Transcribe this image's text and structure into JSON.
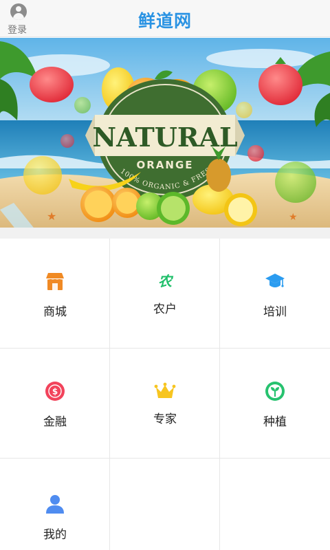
{
  "header": {
    "title": "鲜道网",
    "login_label": "登录"
  },
  "banner": {
    "headline": "NATURAL",
    "subline": "ORANGE",
    "arc_text": "100% ORGANIC & FRESH"
  },
  "menu": {
    "items": [
      {
        "label": "商城",
        "icon": "shop-icon",
        "color": "#f08a24"
      },
      {
        "label": "农户",
        "icon": "farmer-icon",
        "color": "#1fbf6a"
      },
      {
        "label": "培训",
        "icon": "graduation-cap-icon",
        "color": "#2b9cf0"
      },
      {
        "label": "金融",
        "icon": "dollar-coin-icon",
        "color": "#f2435b"
      },
      {
        "label": "专家",
        "icon": "crown-icon",
        "color": "#f7c520"
      },
      {
        "label": "种植",
        "icon": "sprout-icon",
        "color": "#27c26f"
      },
      {
        "label": "我的",
        "icon": "user-icon",
        "color": "#4f8cf0"
      }
    ]
  }
}
